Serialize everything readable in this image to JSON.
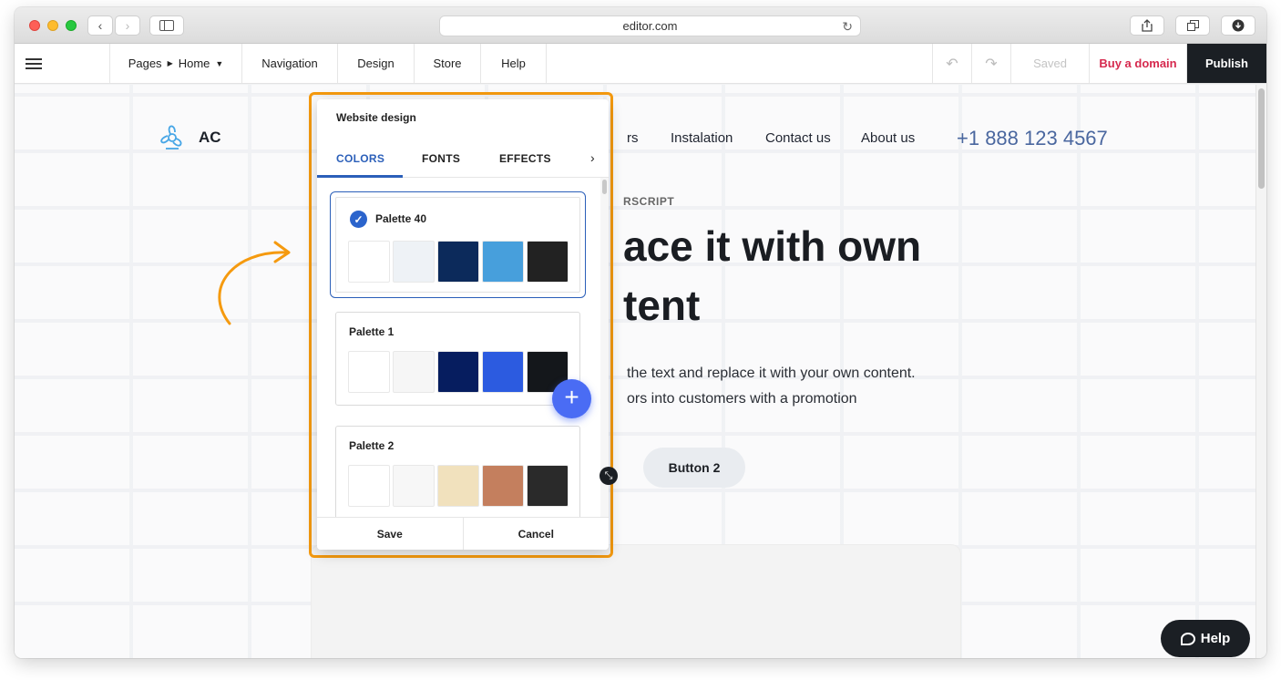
{
  "browser": {
    "url": "editor.com"
  },
  "toolbar": {
    "pages_label": "Pages",
    "home_label": "Home",
    "navigation": "Navigation",
    "design": "Design",
    "store": "Store",
    "help": "Help",
    "saved": "Saved",
    "buy_domain": "Buy a domain",
    "publish": "Publish"
  },
  "site": {
    "logo_text": "AC",
    "nav": [
      "rs",
      "Instalation",
      "Contact us",
      "About us"
    ],
    "phone": "+1 888 123 4567",
    "superscript": "RSCRIPT",
    "hero_line1": "ace it with own",
    "hero_line2": "tent",
    "para_line1": "the text and replace it with your own content.",
    "para_line2": "ors into customers with a promotion",
    "button2": "Button 2",
    "help_button": "Help"
  },
  "panel": {
    "title": "Website design",
    "tabs": [
      "COLORS",
      "FONTS",
      "EFFECTS"
    ],
    "active_tab": "COLORS",
    "palettes": [
      {
        "name": "Palette 40",
        "selected": true,
        "colors": [
          "#ffffff",
          "#eef2f6",
          "#0c2a5b",
          "#479fdc",
          "#222222"
        ]
      },
      {
        "name": "Palette 1",
        "selected": false,
        "colors": [
          "#ffffff",
          "#f6f6f6",
          "#061d5f",
          "#2c5be0",
          "#14171b"
        ]
      },
      {
        "name": "Palette 2",
        "selected": false,
        "colors": [
          "#ffffff",
          "#f7f7f7",
          "#f1e1bd",
          "#c47f5e",
          "#2a2a2a"
        ]
      }
    ],
    "save": "Save",
    "cancel": "Cancel"
  },
  "colors": {
    "highlight_outline": "#f59a0f",
    "accent_blue": "#2b5fb9",
    "fab": "#4a6cf4",
    "buy_domain": "#d6294e",
    "publish_bg": "#1b1f24"
  }
}
